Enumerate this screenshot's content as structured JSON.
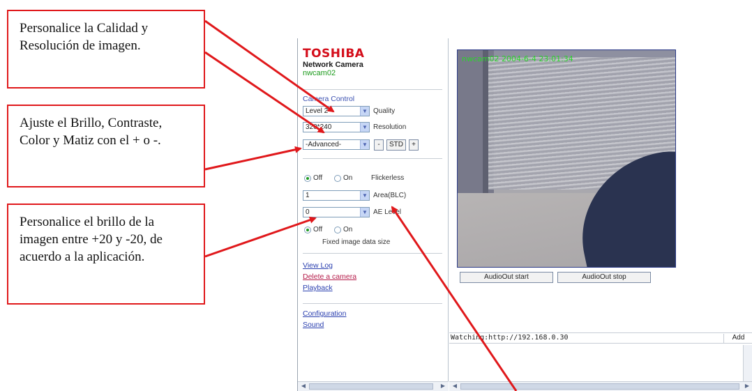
{
  "callouts": {
    "quality_resolution": "Personalice la Calidad y Resolución de imagen.",
    "brightness_contrast": "Ajuste el Brillo, Contraste, Color y Matiz con el + o -.",
    "brightness_range": "Personalice el brillo de la imagen entre +20 y -20, de acuerdo a la aplicación."
  },
  "sidebar": {
    "brand": "TOSHIBA",
    "product": "Network Camera",
    "camera_name": "nwcam02",
    "camera_control_title": "Camera Control",
    "quality": {
      "value": "Level 2",
      "label": "Quality"
    },
    "resolution": {
      "value": "320*240",
      "label": "Resolution"
    },
    "advanced": {
      "value": "-Advanced-",
      "minus": "-",
      "std": "STD",
      "plus": "+"
    },
    "flickerless": {
      "off": "Off",
      "on": "On",
      "label": "Flickerless",
      "selected": "Off"
    },
    "area_blc": {
      "value": "1",
      "label": "Area(BLC)"
    },
    "ae_level": {
      "value": "0",
      "label": "AE Level"
    },
    "fixed_size": {
      "off": "Off",
      "on": "On",
      "label": "Fixed image data size",
      "selected": "Off"
    },
    "links": {
      "view_log": "View Log",
      "delete_camera": "Delete a camera",
      "playback": "Playback",
      "configuration": "Configuration",
      "sound": "Sound"
    }
  },
  "main": {
    "video_overlay": "nwcam02  2004-6-4  23:01:34",
    "audio_start": "AudioOut start",
    "audio_stop": "AudioOut stop",
    "watching": "Watching:http://192.168.0.30",
    "add": "Add"
  },
  "colors": {
    "callout_border": "#e0181b",
    "arrow": "#e0181b",
    "brand_red": "#d40d1a",
    "overlay_green": "#2bd42b"
  }
}
